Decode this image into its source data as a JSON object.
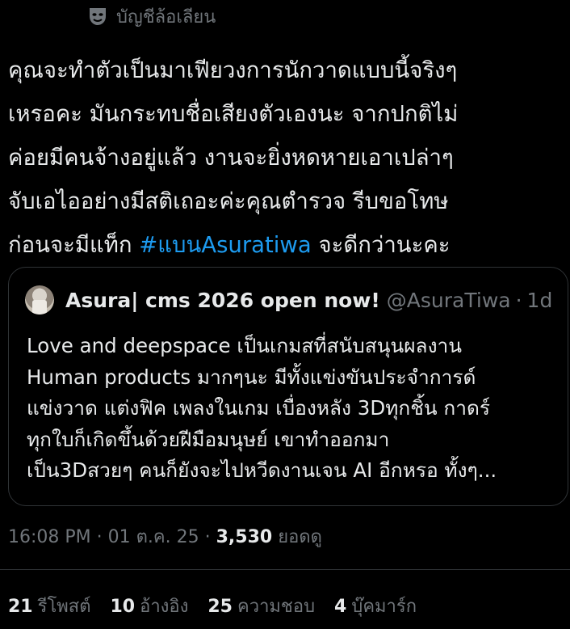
{
  "header": {
    "icon": "theater-mask-icon",
    "account_label": "บัญชีล้อเลียน"
  },
  "tweet": {
    "lines": [
      {
        "text": "คุณจะทำตัวเป็นมาเฟียวงการนักวาดแบบนี้จริงๆ"
      },
      {
        "text": "เหรอคะ มันกระทบชื่อเสียงตัวเองนะ จากปกติไม่"
      },
      {
        "text": "ค่อยมีคนจ้างอยู่แล้ว งานจะยิ่งหดหายเอาเปล่าๆ"
      },
      {
        "text": "จับเอไออย่างมีสติเถอะค่ะคุณตำรวจ รีบขอโทษ"
      }
    ],
    "last_line_before": "ก่อนจะมีแท็ก ",
    "hashtag": "#แบนAsuratiwa",
    "last_line_after": " จะดีกว่านะคะ"
  },
  "quote": {
    "name": "Asura| cms 2026 open now!",
    "handle": "@AsuraTiwa",
    "separator": "·",
    "time": "1d",
    "lines": [
      {
        "text": "Love and deepspace เป็นเกมสที่สนับสนุนผลงาน"
      },
      {
        "text": "Human products มากๆนะ มีทั้งแข่งขันประจำการด์"
      },
      {
        "text": "แข่งวาด แต่งฟิค เพลงในเกม เบื่องหลัง 3Dทุกชิ้น กาดร์"
      },
      {
        "text": "ทุกใบก็เกิดขึ้นด้วยฝีมือมนุษย์ เขาทำออกมา"
      },
      {
        "text": "เป็น3Dสวยๆ คนก็ยังจะไปหวีดงานเจน AI อีกหรอ ทั้งๆ..."
      }
    ]
  },
  "meta": {
    "time": "16:08 PM",
    "dot": "·",
    "date": "01 ต.ค. 25",
    "views_count": "3,530",
    "views_label": "ยอดดู"
  },
  "stats": {
    "reposts_count": "21",
    "reposts_label": "รีโพสต์",
    "quotes_count": "10",
    "quotes_label": "อ้างอิง",
    "likes_count": "25",
    "likes_label": "ความชอบ",
    "bookmarks_count": "4",
    "bookmarks_label": "บุ๊คมาร์ก"
  },
  "colors": {
    "background": "#000000",
    "text": "#e7e9ea",
    "muted": "#71767b",
    "link": "#1d9bf0",
    "border": "#2f3336"
  }
}
